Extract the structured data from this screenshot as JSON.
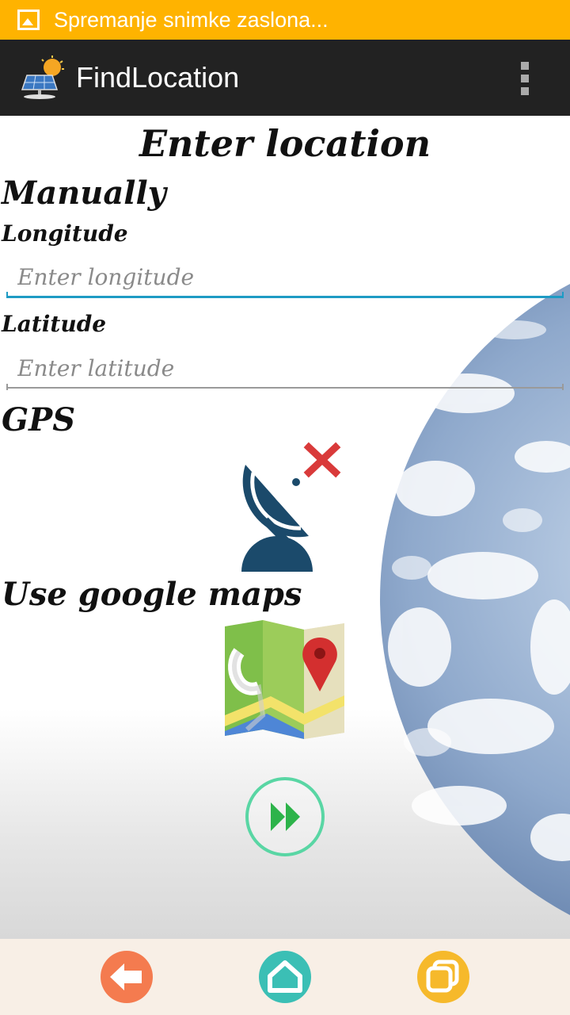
{
  "status_bar": {
    "notification_icon": "image-icon",
    "text": "Spremanje snimke zaslona..."
  },
  "action_bar": {
    "app_icon": "solar-panel-sun-icon",
    "title": "FindLocation",
    "overflow_icon": "more-vert-icon"
  },
  "main": {
    "title": "Enter location",
    "manual_heading": "Manually",
    "longitude": {
      "label": "Longitude",
      "placeholder": "Enter longitude",
      "value": ""
    },
    "latitude": {
      "label": "Latitude",
      "placeholder": "Enter latitude",
      "value": ""
    },
    "gps_heading": "GPS",
    "gps_icon": "satellite-dish-disabled-icon",
    "maps_heading": "Use google maps",
    "maps_icon": "google-maps-icon",
    "next_icon": "fast-forward-icon"
  },
  "nav_bar": {
    "back_icon": "back-arrow-icon",
    "home_icon": "home-icon",
    "recent_icon": "recent-apps-icon"
  },
  "colors": {
    "status_bar": "#ffb300",
    "action_bar": "#222222",
    "focused_underline": "#1e9bc4",
    "gps_dish": "#1b4a6b",
    "gps_cross": "#d93a3a",
    "next_button": "#2db34a",
    "nav_back": "#f47b4f",
    "nav_home": "#3bbfb5",
    "nav_recent": "#f6b92b",
    "nav_bar": "#f8efe6"
  }
}
